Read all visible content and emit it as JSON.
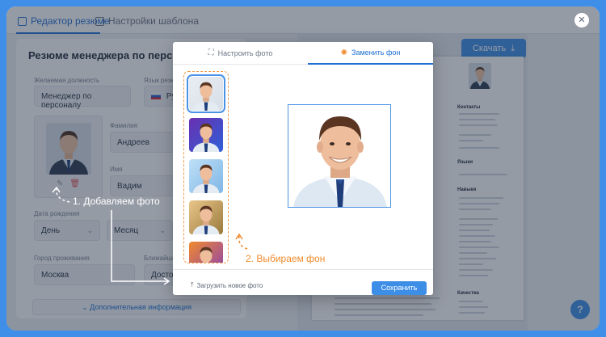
{
  "tabs": [
    {
      "label": "Редактор резюме",
      "active": true,
      "icon": "document-edit-icon"
    },
    {
      "label": "Настройки шаблона",
      "active": false,
      "icon": "grid-icon"
    }
  ],
  "editor": {
    "title": "Резюме менеджера по персоналу",
    "position_label": "Желаемая должность",
    "position_value": "Менеджер по персоналу",
    "language_label": "Язык резюме",
    "language_value": "Русс",
    "surname_label": "Фамилия",
    "surname_value": "Андреев",
    "name_label": "Имя",
    "name_value": "Вадим",
    "birthdate_label": "Дата рождения",
    "day_value": "День",
    "month_value": "Месяц",
    "city_label": "Город проживания",
    "city_value": "Москва",
    "metro_label": "Ближайшая ст",
    "metro_value": "Достоев",
    "more_info": "Дополнительная информация"
  },
  "preview": {
    "download_label": "Скачать",
    "contacts": "Контакты",
    "languages": "Языки",
    "skills": "Навыки",
    "qualities": "Качества"
  },
  "modal": {
    "tab_adjust": "Настроить фото",
    "tab_replace": "Заменить фон",
    "upload_label": "Загрузить новое фото",
    "save_label": "Сохранить"
  },
  "backgrounds": [
    {
      "name": "light-gray",
      "colors": [
        "#e9eef3",
        "#d7dee6"
      ]
    },
    {
      "name": "purple-blue",
      "colors": [
        "#6a2fb0",
        "#2f5fd8"
      ]
    },
    {
      "name": "sky-blue",
      "colors": [
        "#bfe0f7",
        "#7fb6e6"
      ]
    },
    {
      "name": "autumn-park",
      "colors": [
        "#e9c58a",
        "#9a7a3c"
      ]
    },
    {
      "name": "sunset-purple",
      "colors": [
        "#f08a2c",
        "#8a3fb5"
      ]
    }
  ],
  "callouts": {
    "step1": "1. Добавляем фото",
    "step2": "2. Выбираем фон"
  },
  "help_label": "?",
  "close_label": "✕",
  "colors": {
    "accent": "#1f6fd1",
    "button": "#3d8ee6",
    "frame": "#3f8fe8",
    "callout_orange": "#f08a2c"
  }
}
